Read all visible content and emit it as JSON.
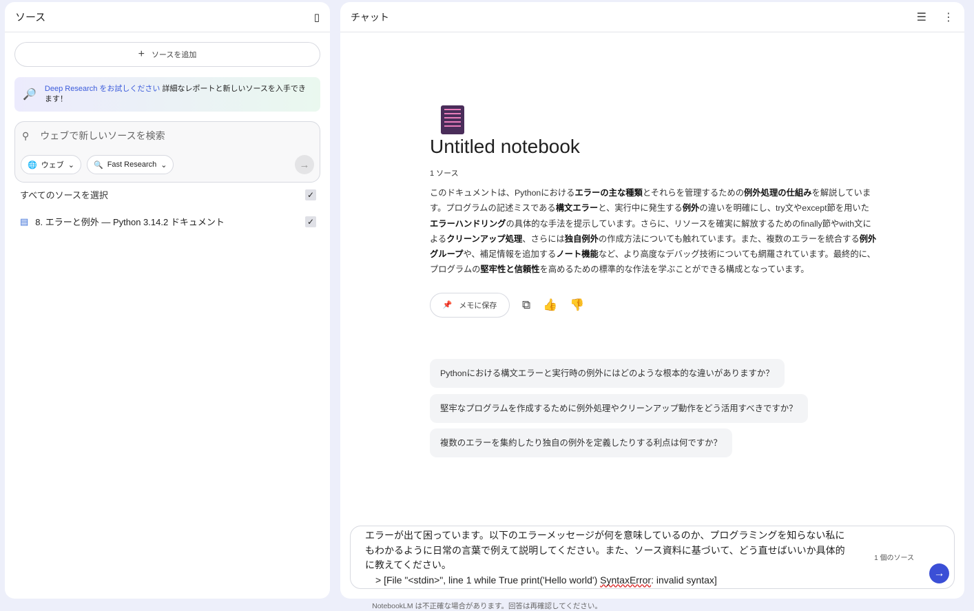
{
  "sources": {
    "title": "ソース",
    "add_label": "ソースを追加",
    "deep": {
      "link": "Deep Research をお試しください",
      "text": " 詳細なレポートと新しいソースを入手できます！"
    },
    "search_placeholder": "ウェブで新しいソースを検索",
    "web_chip": "ウェブ",
    "research_chip": "Fast Research",
    "select_all": "すべてのソースを選択",
    "items": [
      {
        "label": "8. エラーと例外 — Python 3.14.2 ドキュメント",
        "checked": true
      }
    ]
  },
  "chat": {
    "title": "チャット",
    "notebook_title": "Untitled notebook",
    "source_count": "1 ソース",
    "summary": [
      {
        "t": "このドキュメントは、Pythonにおける"
      },
      {
        "t": "エラーの主な種類",
        "b": true
      },
      {
        "t": "とそれらを管理するための"
      },
      {
        "t": "例外処理の仕組み",
        "b": true
      },
      {
        "t": "を解説しています。プログラムの記述ミスである"
      },
      {
        "t": "構文エラー",
        "b": true
      },
      {
        "t": "と、実行中に発生する"
      },
      {
        "t": "例外",
        "b": true
      },
      {
        "t": "の違いを明確にし、try文やexcept節を用いた"
      },
      {
        "t": "エラーハンドリング",
        "b": true
      },
      {
        "t": "の具体的な手法を提示しています。さらに、リソースを確実に解放するためのfinally節やwith文による"
      },
      {
        "t": "クリーンアップ処理",
        "b": true
      },
      {
        "t": "、さらには"
      },
      {
        "t": "独自例外",
        "b": true
      },
      {
        "t": "の作成方法についても触れています。また、複数のエラーを統合する"
      },
      {
        "t": "例外グループ",
        "b": true
      },
      {
        "t": "や、補足情報を追加する"
      },
      {
        "t": "ノート機能",
        "b": true
      },
      {
        "t": "など、より高度なデバッグ技術についても網羅されています。最終的に、プログラムの"
      },
      {
        "t": "堅牢性と信頼性",
        "b": true
      },
      {
        "t": "を高めるための標準的な作法を学ぶことができる構成となっています。"
      }
    ],
    "save_memo": "メモに保存",
    "suggestions": [
      "Pythonにおける構文エラーと実行時の例外にはどのような根本的な違いがありますか？",
      "堅牢なプログラムを作成するために例外処理やクリーンアップ動作をどう活用すべきですか？",
      "複数のエラーを集約したり独自の例外を定義したりする利点は何ですか？"
    ],
    "input": {
      "text": "エラーが出て困っています。以下のエラーメッセージが何を意味しているのか、プログラミングを知らない私にもわかるように日常の言葉で例えて説明してください。また、ソース資料に基づいて、どう直せばいいか具体的に教えてください。",
      "error_pre": "> [File \"<stdin>\", line 1 while True print('Hello world') ",
      "error_word": "SyntaxError",
      "error_post": ": invalid syntax]"
    },
    "source_count_badge": "1 個のソース",
    "footer": "NotebookLM は不正確な場合があります。回答は再確認してください。"
  }
}
